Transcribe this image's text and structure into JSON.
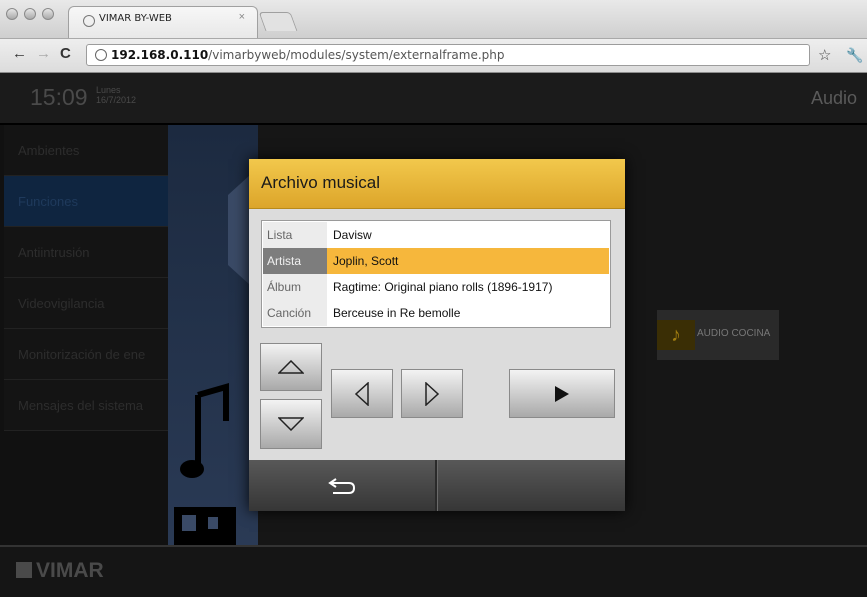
{
  "browser": {
    "tab_title": "VIMAR BY-WEB",
    "tab_close": "×",
    "url_host": "192.168.0.110",
    "url_path": "/vimarbyweb/modules/system/externalframe.php"
  },
  "header": {
    "time": "15:09",
    "day": "Lunes",
    "date": "16/7/2012",
    "title": "Audio"
  },
  "sidebar": {
    "items": [
      {
        "label": "Ambientes"
      },
      {
        "label": "Funciones"
      },
      {
        "label": "Antiintrusión"
      },
      {
        "label": "Videovigilancia"
      },
      {
        "label": "Monitorización de ene"
      },
      {
        "label": "Mensajes del sistema"
      }
    ]
  },
  "content": {
    "audio_item_label": "AUDIO COCINA"
  },
  "dialog": {
    "title": "Archivo musical",
    "rows": [
      {
        "key": "Lista",
        "value": "Davisw"
      },
      {
        "key": "Artista",
        "value": "Joplin, Scott"
      },
      {
        "key": "Álbum",
        "value": "Ragtime: Original piano rolls (1896-1917)"
      },
      {
        "key": "Canción",
        "value": "Berceuse in Re bemolle"
      }
    ],
    "selected_row": "Artista"
  },
  "footer": {
    "brand": "VIMAR"
  },
  "colors": {
    "accent": "#f6b73c",
    "header_gold": "#e8b83a"
  }
}
